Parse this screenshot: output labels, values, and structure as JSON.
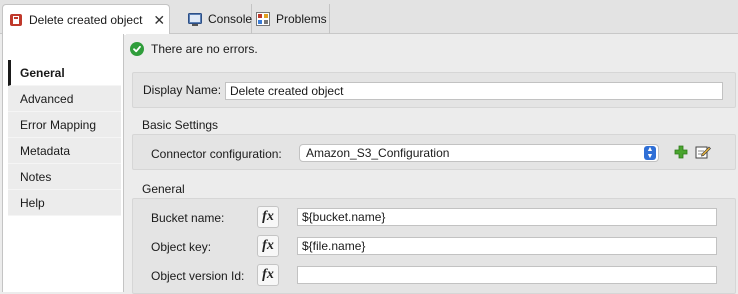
{
  "tabs": [
    {
      "label": "Delete created object",
      "icon": "mule-component-icon",
      "active": true
    },
    {
      "label": "Console",
      "icon": "console-icon",
      "active": false
    },
    {
      "label": "Problems",
      "icon": "problems-icon",
      "active": false
    }
  ],
  "sidebar": {
    "items": [
      {
        "label": "General",
        "active": true
      },
      {
        "label": "Advanced",
        "active": false
      },
      {
        "label": "Error Mapping",
        "active": false
      },
      {
        "label": "Metadata",
        "active": false
      },
      {
        "label": "Notes",
        "active": false
      },
      {
        "label": "Help",
        "active": false
      }
    ]
  },
  "status": {
    "text": "There are no errors.",
    "icon": "success-check-icon"
  },
  "display_name": {
    "label": "Display Name:",
    "value": "Delete created object"
  },
  "basic_settings": {
    "title": "Basic Settings",
    "connector_label": "Connector configuration:",
    "connector_value": "Amazon_S3_Configuration"
  },
  "general": {
    "title": "General",
    "fields": [
      {
        "label": "Bucket name:",
        "value": "${bucket.name}"
      },
      {
        "label": "Object key:",
        "value": "${file.name}"
      },
      {
        "label": "Object version Id:",
        "value": ""
      }
    ],
    "fx_label": "fx"
  },
  "colors": {
    "success": "#2f9d3b",
    "select_accent": "#2f6fd6",
    "add_green": "#3a9a2a"
  }
}
